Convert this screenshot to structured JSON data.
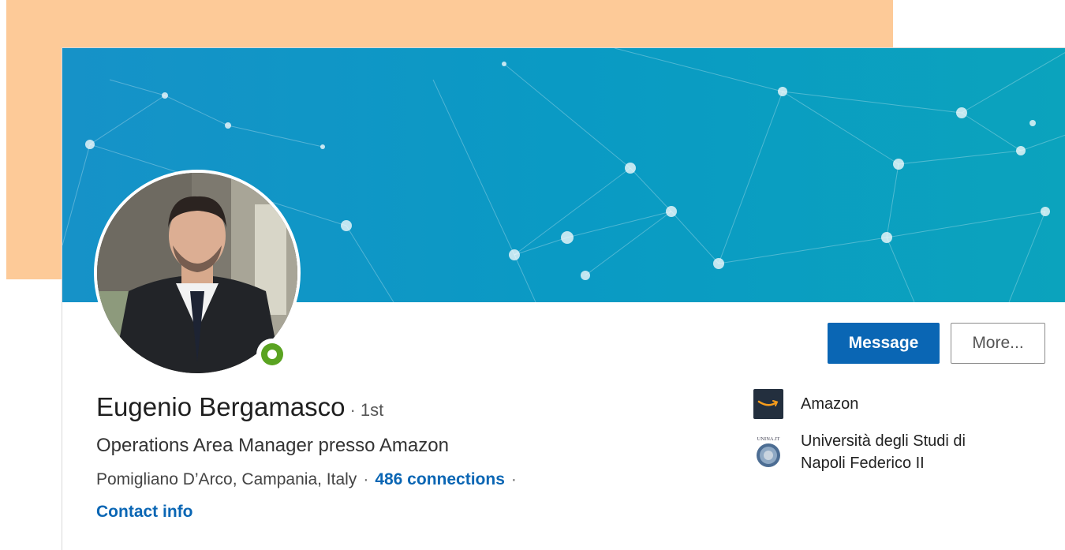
{
  "profile": {
    "name": "Eugenio Bergamasco",
    "separator": "·",
    "degree": "1st",
    "headline": "Operations Area Manager presso Amazon",
    "location": "Pomigliano D’Arco, Campania, Italy",
    "dot": "·",
    "connections": "486 connections",
    "contact_info": "Contact info",
    "online_status_color": "#5aa321"
  },
  "actions": {
    "message_label": "Message",
    "more_label": "More..."
  },
  "experience": {
    "company": "Amazon",
    "school": "Università degli Studi di Napoli Federico II",
    "school_logo_text": "UNINA.IT"
  },
  "colors": {
    "background_accent": "#fdca98",
    "banner": "#1692c8",
    "primary": "#0a66b4",
    "amazon_logo_bg": "#232f3e"
  }
}
